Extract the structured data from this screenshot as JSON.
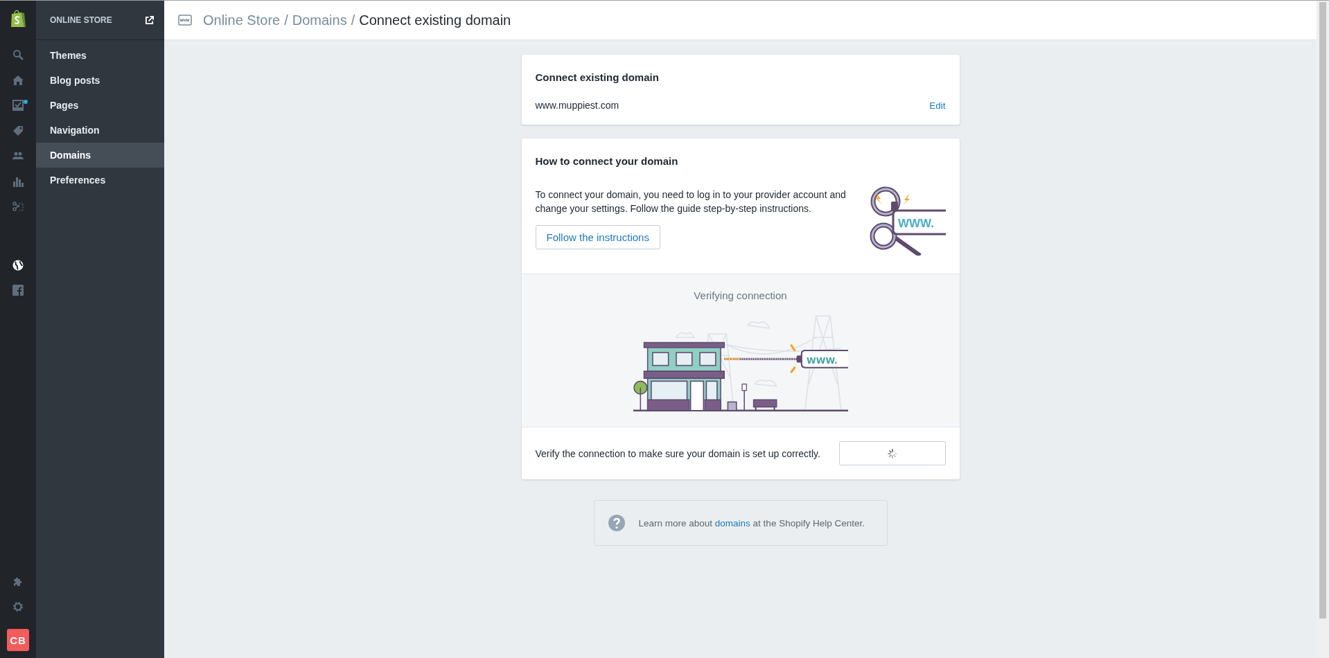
{
  "rail": {
    "items": [
      {
        "selected": false,
        "badge": false
      },
      {
        "selected": false,
        "badge": false
      },
      {
        "selected": false,
        "badge": true
      },
      {
        "selected": false,
        "badge": false
      },
      {
        "selected": false,
        "badge": false
      },
      {
        "selected": false,
        "badge": false
      },
      {
        "selected": false,
        "badge": false
      },
      {
        "selected": true,
        "badge": false
      },
      {
        "selected": false,
        "badge": false
      }
    ],
    "bottom_items": [
      {
        "selected": false
      },
      {
        "selected": false
      }
    ],
    "avatar": "CB"
  },
  "sidebar": {
    "title": "ONLINE STORE",
    "items": [
      {
        "label": "Themes",
        "selected": false
      },
      {
        "label": "Blog posts",
        "selected": false
      },
      {
        "label": "Pages",
        "selected": false
      },
      {
        "label": "Navigation",
        "selected": false
      },
      {
        "label": "Domains",
        "selected": true
      },
      {
        "label": "Preferences",
        "selected": false
      }
    ]
  },
  "breadcrumb": [
    {
      "label": "Online Store",
      "current": false
    },
    {
      "label": "Domains",
      "current": false
    },
    {
      "label": "Connect existing domain",
      "current": true
    }
  ],
  "breadcrumb_separator": "/",
  "domain_card": {
    "title": "Connect existing domain",
    "domain": "www.muppiest.com",
    "edit_link": "Edit"
  },
  "connect_card": {
    "title": "How to connect your domain",
    "text": "To connect your domain, you need to log in to your provider account and change your settings. Follow the guide step-by-step instructions.",
    "button": "Follow the instructions",
    "key_label": "WWW.",
    "verify": {
      "heading": "Verifying connection",
      "plug_label": "WWW.",
      "text": "Verify the connection to make sure your domain is set up correctly.",
      "loading": true
    }
  },
  "help": {
    "before": "Learn more about",
    "link": "domains",
    "after": "at the Shopify Help Center."
  }
}
